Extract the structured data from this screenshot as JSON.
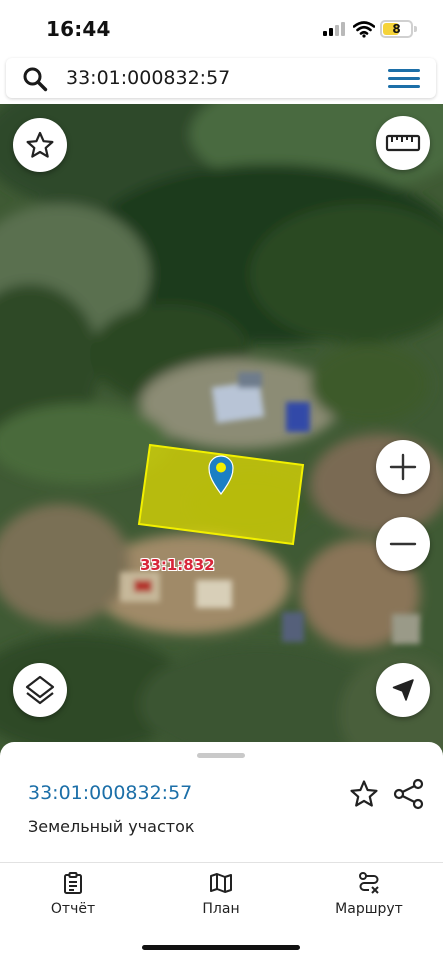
{
  "status_bar": {
    "time": "16:44",
    "battery": "8",
    "icons": [
      "signal-icon",
      "wifi-icon",
      "battery-icon"
    ]
  },
  "search": {
    "value": "33:01:000832:57",
    "icon": "search-icon",
    "menu_icon": "menu-icon"
  },
  "map": {
    "parcel_label": "33:1:832",
    "selected_parcel_color": "#e6e000",
    "accent_color": "#1c6fa8",
    "controls": {
      "favorite_icon": "star-icon",
      "ruler_icon": "ruler-icon",
      "zoom_in_icon": "plus-icon",
      "zoom_out_icon": "minus-icon",
      "layers_icon": "layers-icon",
      "locate_icon": "location-arrow-icon",
      "marker_icon": "map-pin-icon"
    }
  },
  "sheet": {
    "title": "33:01:000832:57",
    "subtitle": "Земельный участок",
    "favorite_icon": "star-icon",
    "share_icon": "share-icon"
  },
  "bottom_nav": {
    "items": [
      {
        "label": "Отчёт",
        "icon": "clipboard-icon"
      },
      {
        "label": "План",
        "icon": "map-icon"
      },
      {
        "label": "Маршрут",
        "icon": "route-icon"
      }
    ]
  }
}
